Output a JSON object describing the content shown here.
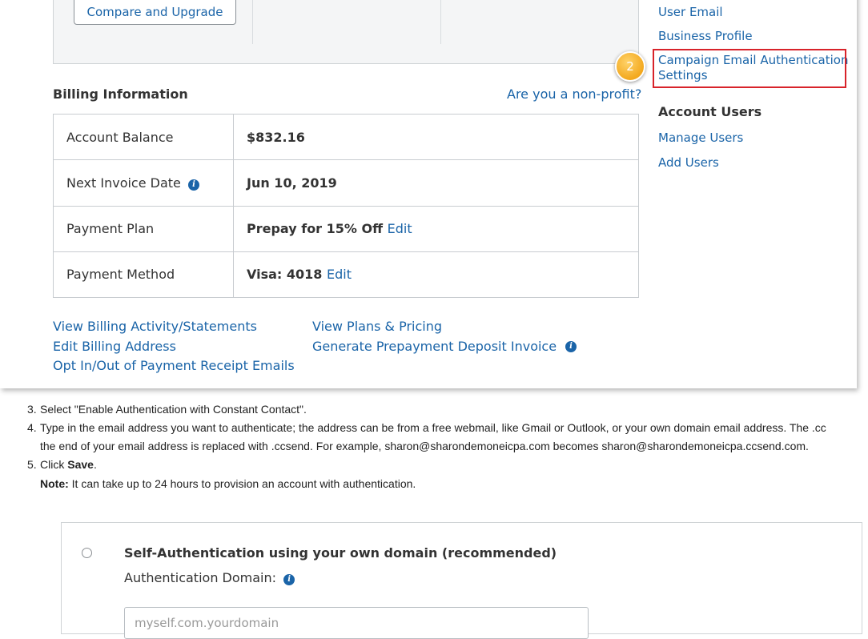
{
  "top": {
    "compare_button": "Compare and Upgrade"
  },
  "billing": {
    "title": "Billing Information",
    "nonprofit_link": "Are you a non-profit?",
    "rows": [
      {
        "label": "Account Balance",
        "value": "$832.16",
        "edit": ""
      },
      {
        "label": "Next Invoice Date",
        "value": "Jun 10, 2019",
        "edit": ""
      },
      {
        "label": "Payment Plan",
        "value": "Prepay for 15% Off",
        "edit": "Edit"
      },
      {
        "label": "Payment Method",
        "value": "Visa: 4018",
        "edit": "Edit"
      }
    ],
    "links_left": [
      "View Billing Activity/Statements",
      "Edit Billing Address",
      "Opt In/Out of Payment Receipt Emails"
    ],
    "links_right": [
      "View Plans & Pricing",
      "Generate Prepayment Deposit Invoice"
    ]
  },
  "sidebar": {
    "links": [
      "User Email",
      "Business Profile",
      "Campaign Email Authentication",
      "Settings"
    ],
    "account_users_heading": "Account Users",
    "account_users_links": [
      "Manage Users",
      "Add Users"
    ]
  },
  "callout": {
    "step": "2"
  },
  "info_glyph": "i",
  "instructions": {
    "step3": {
      "num": "3.",
      "text": "Select \"Enable Authentication with Constant Contact\"."
    },
    "step4": {
      "num": "4.",
      "line1": "Type in the email address you want to authenticate; the address can be from a free webmail, like Gmail or Outlook, or your own domain email address. The .cc",
      "line2": "the end of your email address is replaced with .ccsend. For example, sharon@sharondemoneicpa.com becomes sharon@sharondemoneicpa.ccsend.com."
    },
    "step5": {
      "num": "5.",
      "pre": "Click ",
      "bold": "Save",
      "post": "."
    },
    "note": {
      "bold": "Note:",
      "text": " It can take up to 24 hours to provision an account with authentication."
    }
  },
  "auth": {
    "title": "Self-Authentication using your own domain (recommended)",
    "domain_label": "Authentication Domain:",
    "input_text": "myself.com.yourdomain"
  },
  "colors": {
    "link": "#1a64a8",
    "highlight": "#d8232a",
    "badge": "#f3a81e"
  }
}
